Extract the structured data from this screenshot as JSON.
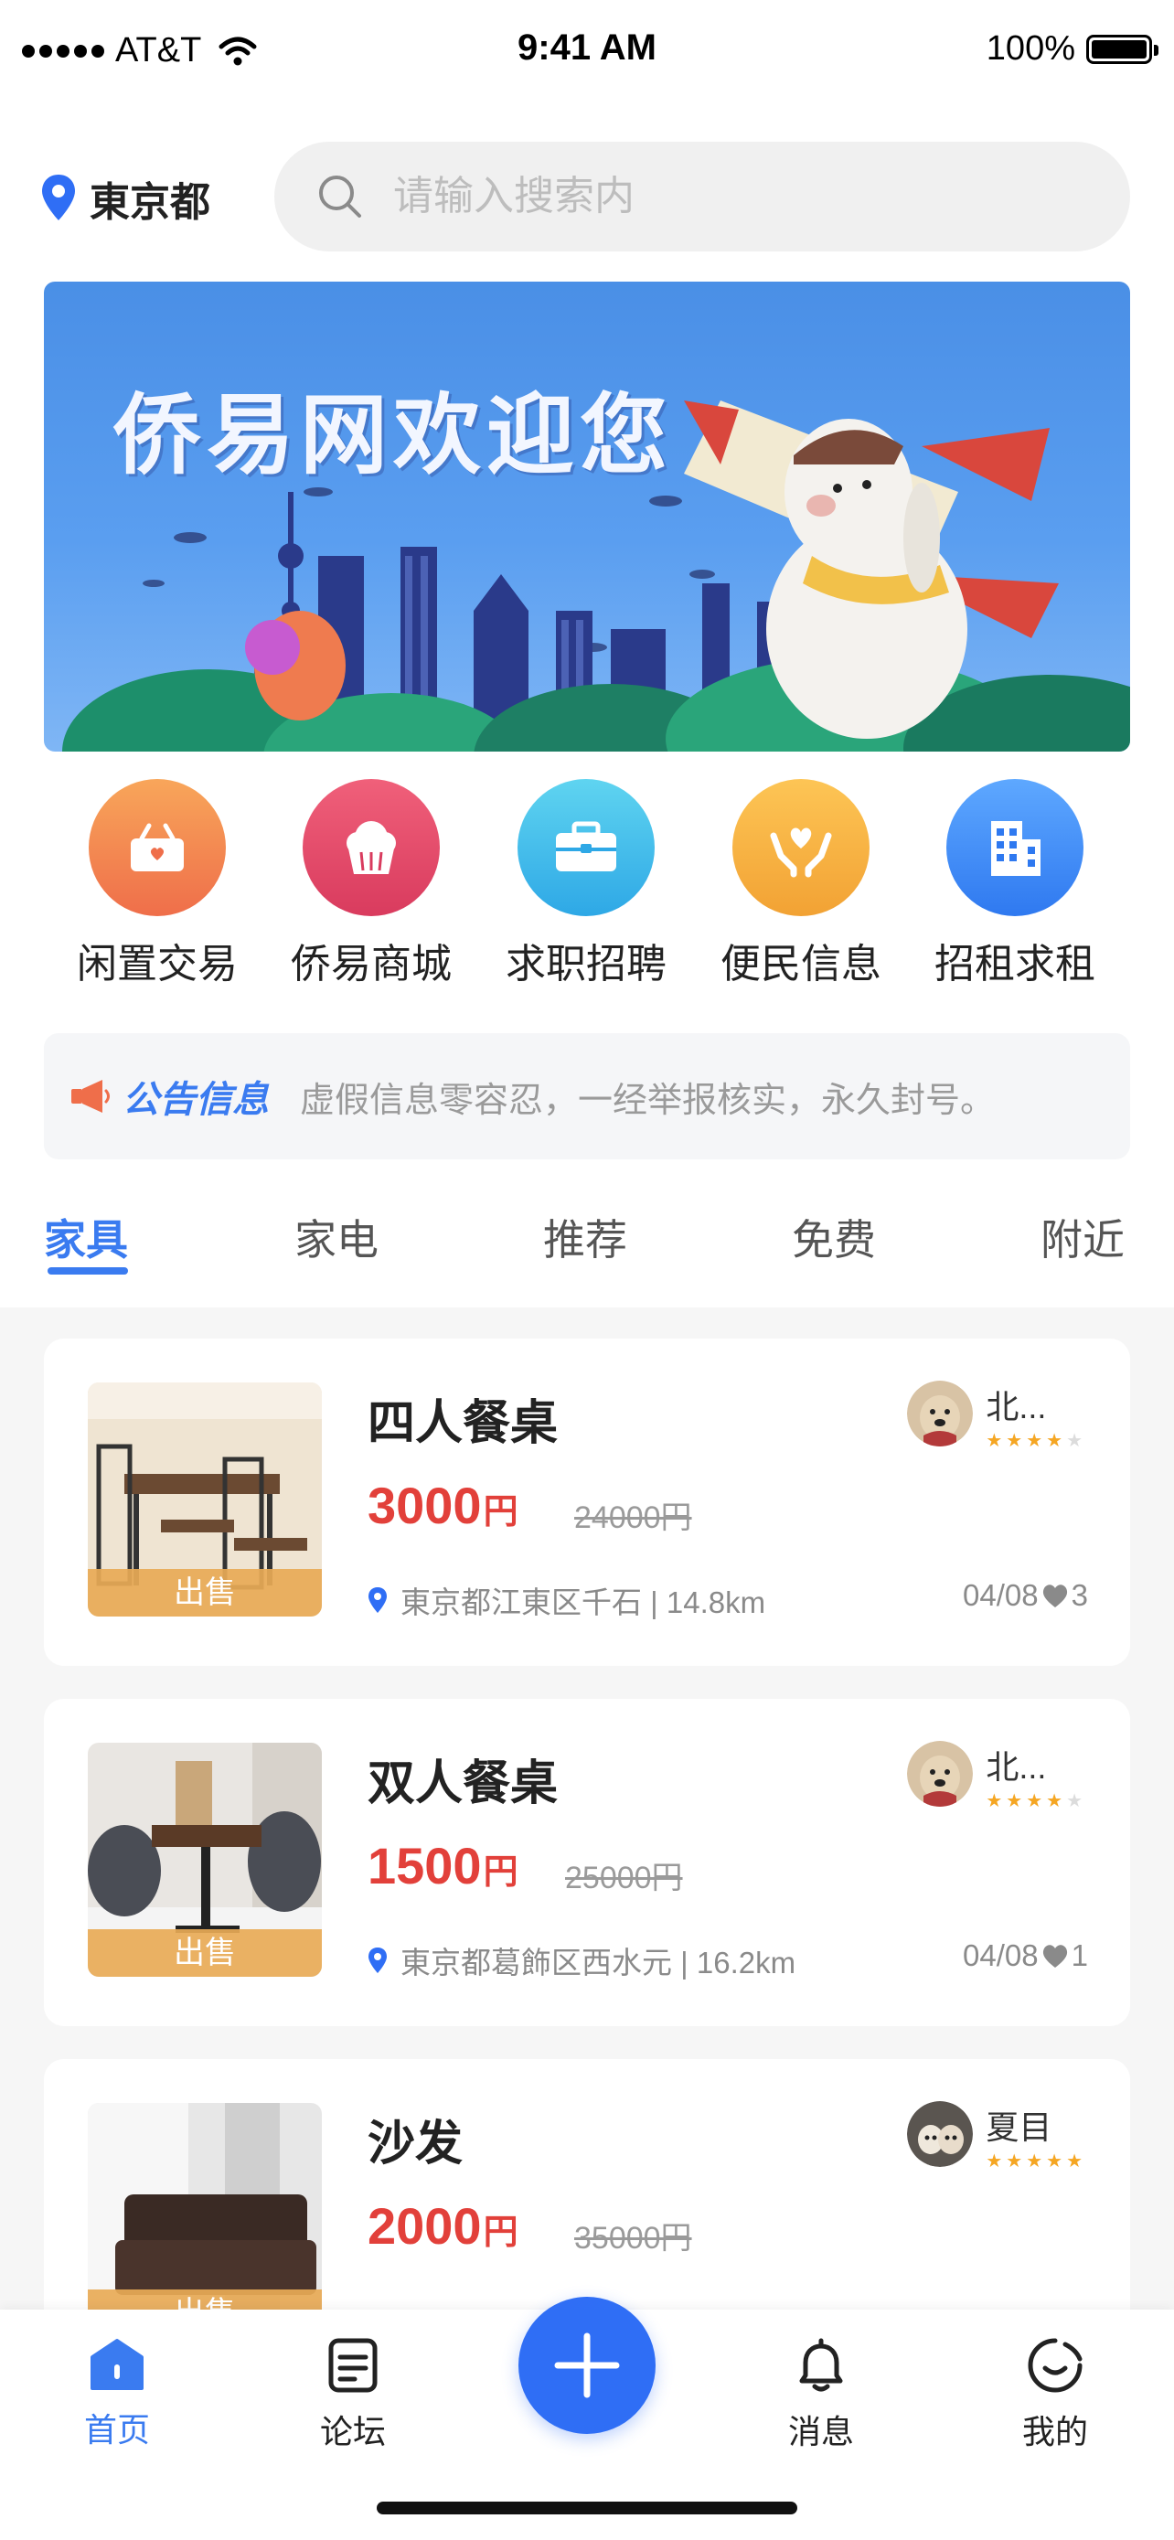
{
  "status_bar": {
    "carrier": "AT&T",
    "time": "9:41 AM",
    "battery": "100%"
  },
  "header": {
    "city": "東京都",
    "search_placeholder": "请输入搜索内"
  },
  "banner": {
    "title": "侨易网欢迎您"
  },
  "categories": [
    {
      "label": "闲置交易",
      "icon": "basket-icon",
      "color_from": "#f8a65a",
      "color_to": "#ef6e4a"
    },
    {
      "label": "侨易商城",
      "icon": "cupcake-icon",
      "color_from": "#f0607a",
      "color_to": "#d93b5e"
    },
    {
      "label": "求职招聘",
      "icon": "briefcase-icon",
      "color_from": "#5fd4f0",
      "color_to": "#2ea8e6"
    },
    {
      "label": "便民信息",
      "icon": "heart-hands-icon",
      "color_from": "#fdc555",
      "color_to": "#f2a234"
    },
    {
      "label": "招租求租",
      "icon": "building-icon",
      "color_from": "#5ea8ff",
      "color_to": "#2f79f0"
    }
  ],
  "notice": {
    "title": "公告信息",
    "text": "虚假信息零容忍，一经举报核实，永久封号。"
  },
  "tabs": [
    {
      "label": "家具",
      "active": true
    },
    {
      "label": "家电",
      "active": false
    },
    {
      "label": "推荐",
      "active": false
    },
    {
      "label": "免费",
      "active": false
    },
    {
      "label": "附近",
      "active": false
    }
  ],
  "listings": [
    {
      "title": "四人餐桌",
      "price": "3000",
      "unit": "円",
      "original_price": "24000円",
      "badge": "出售",
      "address": "東京都江東区千石 | 14.8km",
      "date": "04/08",
      "likes": "3",
      "seller": "北...",
      "rating": 4
    },
    {
      "title": "双人餐桌",
      "price": "1500",
      "unit": "円",
      "original_price": "25000円",
      "badge": "出售",
      "address": "東京都葛飾区西水元 | 16.2km",
      "date": "04/08",
      "likes": "1",
      "seller": "北...",
      "rating": 4
    },
    {
      "title": "沙发",
      "price": "2000",
      "unit": "円",
      "original_price": "35000円",
      "badge": "出售",
      "address": "",
      "date": "",
      "likes": "",
      "seller": "夏目",
      "rating": 5
    }
  ],
  "tab_bar": {
    "home": "首页",
    "forum": "论坛",
    "messages": "消息",
    "me": "我的"
  },
  "colors": {
    "accent": "#3a7bf0",
    "price": "#e2403a",
    "star": "#f5a623",
    "ribbon": "#e8aa56"
  }
}
